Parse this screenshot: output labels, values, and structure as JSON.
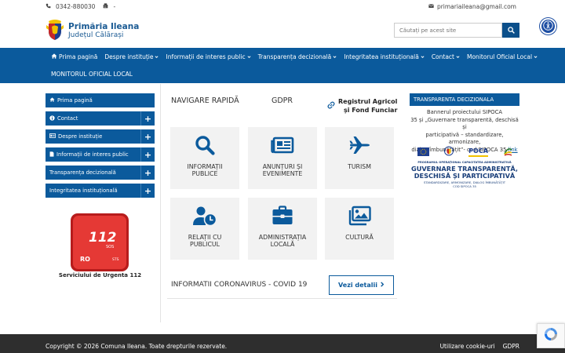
{
  "topbar": {
    "phone": "0342-880030",
    "fax": "-",
    "email": "primariaileana@gmail.com"
  },
  "header": {
    "title": "Primăria Ileana",
    "subtitle": "Județul Călărași",
    "search_placeholder": "Căutați pe acest site"
  },
  "nav": {
    "row1": [
      {
        "label": "Prima pagină",
        "icon": "home-icon",
        "dropdown": false
      },
      {
        "label": "Despre instituție",
        "dropdown": true
      },
      {
        "label": "Informații de interes public",
        "dropdown": true
      },
      {
        "label": "Transparența decizională",
        "dropdown": true
      },
      {
        "label": "Integritatea instituțională",
        "dropdown": true
      },
      {
        "label": "Contact",
        "dropdown": true
      },
      {
        "label": "Monitorul Oficial Local",
        "dropdown": true
      }
    ],
    "row2": [
      {
        "label": "MONITORUL OFICIAL LOCAL",
        "dropdown": false
      }
    ]
  },
  "sidebar": {
    "items": [
      {
        "label": "Prima pagină",
        "icon": "home-icon",
        "plus": false
      },
      {
        "label": "Contact",
        "icon": "info-icon",
        "plus": true
      },
      {
        "label": "Despre instituție",
        "icon": "id-card-icon",
        "plus": true
      },
      {
        "label": "Informații de interes public",
        "icon": "file-icon",
        "plus": true
      },
      {
        "label": "Transparența decizională",
        "icon": "",
        "plus": true
      },
      {
        "label": "Integritatea instituțională",
        "icon": "",
        "plus": true
      }
    ],
    "badge": {
      "number": "112",
      "sos": "SOS",
      "country": "RO",
      "sts": "STS",
      "caption": "Serviciului de Urgenta 112"
    }
  },
  "main": {
    "quick_nav": "NAVIGARE RAPIDĂ",
    "gdpr": "GDPR",
    "registru": {
      "line1": "Registrul Agricol",
      "line2": "și Fond Funciar"
    },
    "tiles": [
      {
        "line1": "INFORMAȚII",
        "line2": "PUBLICE",
        "icon": "search-icon"
      },
      {
        "line1": "ANUNȚURI ȘI",
        "line2": "EVENIMENTE",
        "icon": "newspaper-icon"
      },
      {
        "line1": "TURISM",
        "line2": "",
        "icon": "plane-icon"
      },
      {
        "line1": "RELAȚII CU",
        "line2": "PUBLICUL",
        "icon": "user-clock-icon"
      },
      {
        "line1": "ADMINISTRAȚIA",
        "line2": "LOCALĂ",
        "icon": "briefcase-icon"
      },
      {
        "line1": "CULTURĂ",
        "line2": "",
        "icon": "image-icon"
      }
    ],
    "covid": {
      "title": "INFORMATII CORONAVIRUS - COVID 19",
      "button": "Vezi detalii"
    }
  },
  "right_panel": {
    "title": "TRANSPARENTA DECIZIONALA",
    "text_line1": "Bannerul proiectului SIPOCA",
    "text_line2": "35 și „Guvernare transparentă, deschisă și",
    "text_line3": "participativă – standardizare, armonizare,",
    "text_line4": "dialog îmbunătățit”- cod SIPOCA 35",
    "link": "link",
    "poca": "POCA",
    "program": "PROGRAMUL OPERAȚIONAL CAPACITATEA ADMINISTRATIVĂ",
    "big1": "GUVERNARE TRANSPARENTĂ,",
    "big2": "DESCHISĂ ȘI PARTICIPATIVĂ",
    "small1": "STANDARDIZARE, ARMONIZARE, DIALOG ÎMBUNĂTĂȚIT",
    "small2": "COD SIPOCA 35"
  },
  "footer": {
    "copyright": "Copyright © 2026 Comuna Ileana. Toate drepturile rezervate.",
    "links": [
      "Utilizare cookie-uri",
      "GDPR"
    ]
  },
  "colors": {
    "primary": "#0b5a9c",
    "tile_bg": "#f2f2f2",
    "footer": "#2e2e2e",
    "accent_red": "#e53935"
  }
}
